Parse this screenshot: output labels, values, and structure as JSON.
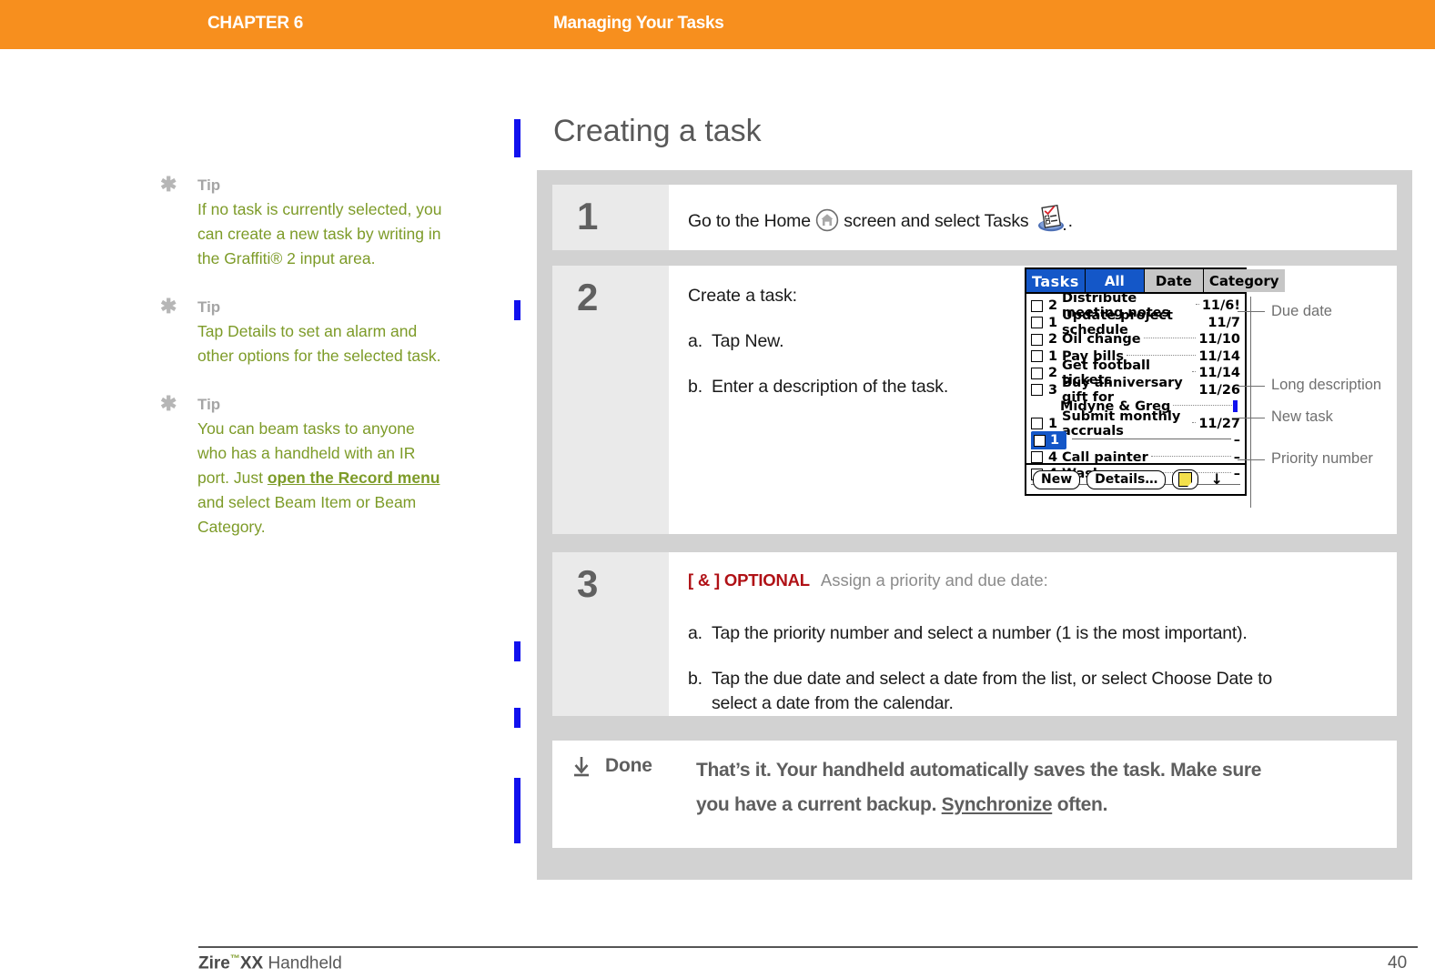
{
  "header": {
    "chapter": "CHAPTER 6",
    "title": "Managing Your Tasks",
    "band_color": "#F78F1E"
  },
  "section": {
    "title": "Creating a task"
  },
  "tips": [
    {
      "icon": "asterisk-icon",
      "label": "Tip",
      "text_before": "If no task is currently selected, you can create a new task by writing in the Graffiti® 2 input area.",
      "link": "",
      "text_after": ""
    },
    {
      "icon": "asterisk-icon",
      "label": "Tip",
      "text_before": "Tap Details to set an alarm and other options for the selected task.",
      "link": "",
      "text_after": ""
    },
    {
      "icon": "asterisk-icon",
      "label": "Tip",
      "text_before": "You can beam tasks to anyone who has a handheld with an IR port. Just ",
      "link": "open the Record menu",
      "text_after": " and select Beam Item or Beam Category."
    }
  ],
  "steps": [
    {
      "number": "1",
      "text_before": "Go to the Home ",
      "icon1": "home-icon",
      "text_middle": " screen and select Tasks ",
      "icon2": "tasks-app-icon",
      "text_after": "."
    },
    {
      "number": "2",
      "intro": "Create a task:",
      "substeps": [
        {
          "marker": "a.",
          "text": "Tap New."
        },
        {
          "marker": "b.",
          "text": "Enter a description of the task."
        }
      ]
    },
    {
      "number": "3",
      "optional_tag": "[ & ] OPTIONAL",
      "optional_color": "#B01116",
      "intro": "Assign a priority and due date:",
      "substeps": [
        {
          "marker": "a.",
          "text": "Tap the priority number and select a number (1 is the most important)."
        },
        {
          "marker": "b.",
          "text": "Tap the due date and select a date from the list, or select Choose Date to"
        },
        {
          "marker": "",
          "text": "select a date from the calendar."
        }
      ]
    }
  ],
  "done": {
    "icon": "download-arrow-icon",
    "label": "Done",
    "line1_before": "That’s it. Your handheld automatically saves the task. Make sure",
    "line2_before": "you have a current backup. ",
    "link": "Synchronize",
    "line2_after": " often."
  },
  "pda": {
    "app_name": "Tasks",
    "tabs": [
      {
        "label": "All",
        "selected": true
      },
      {
        "label": "Date",
        "selected": false
      },
      {
        "label": "Category",
        "selected": false
      }
    ],
    "tasks": [
      {
        "priority": "2",
        "desc": "Distribute meeting notes",
        "date": "11/6!",
        "dots": true
      },
      {
        "priority": "1",
        "desc": "Update project schedule",
        "date": "11/7",
        "dots": false
      },
      {
        "priority": "2",
        "desc": "Oil change",
        "date": "11/10",
        "dots": true
      },
      {
        "priority": "1",
        "desc": "Pay bills",
        "date": "11/14",
        "dots": true
      },
      {
        "priority": "2",
        "desc": "Get football tickets",
        "date": "11/14",
        "dots": true
      },
      {
        "priority": "3",
        "desc": "Buy anniversary gift for",
        "date": "11/26",
        "dots": false
      },
      {
        "priority": "",
        "desc": "Midyne & Greg",
        "date": "",
        "dots": true,
        "continuation": true
      },
      {
        "priority": "1",
        "desc": "Submit monthly accruals",
        "date": "11/27",
        "dots": true
      },
      {
        "priority": "1",
        "desc": "",
        "date": "–",
        "dots": false,
        "newtask": true
      },
      {
        "priority": "4",
        "desc": "Call painter",
        "date": "–",
        "dots": true
      },
      {
        "priority": "4",
        "desc": "Wash car",
        "date": "–",
        "dots": true
      }
    ],
    "buttons": [
      {
        "label": "New",
        "name": "new-button"
      },
      {
        "label": "Details…",
        "name": "details-button"
      }
    ],
    "note_icon": "note-icon",
    "scroll_indicator": "↓",
    "title_bg": "#1457C8"
  },
  "callouts": [
    {
      "label": "Due date"
    },
    {
      "label": "Long description"
    },
    {
      "label": "New task"
    },
    {
      "label": "Priority number"
    }
  ],
  "footer": {
    "brand": "Zire",
    "tm": "™",
    "model": "XX",
    "product": " Handheld",
    "page": "40"
  }
}
